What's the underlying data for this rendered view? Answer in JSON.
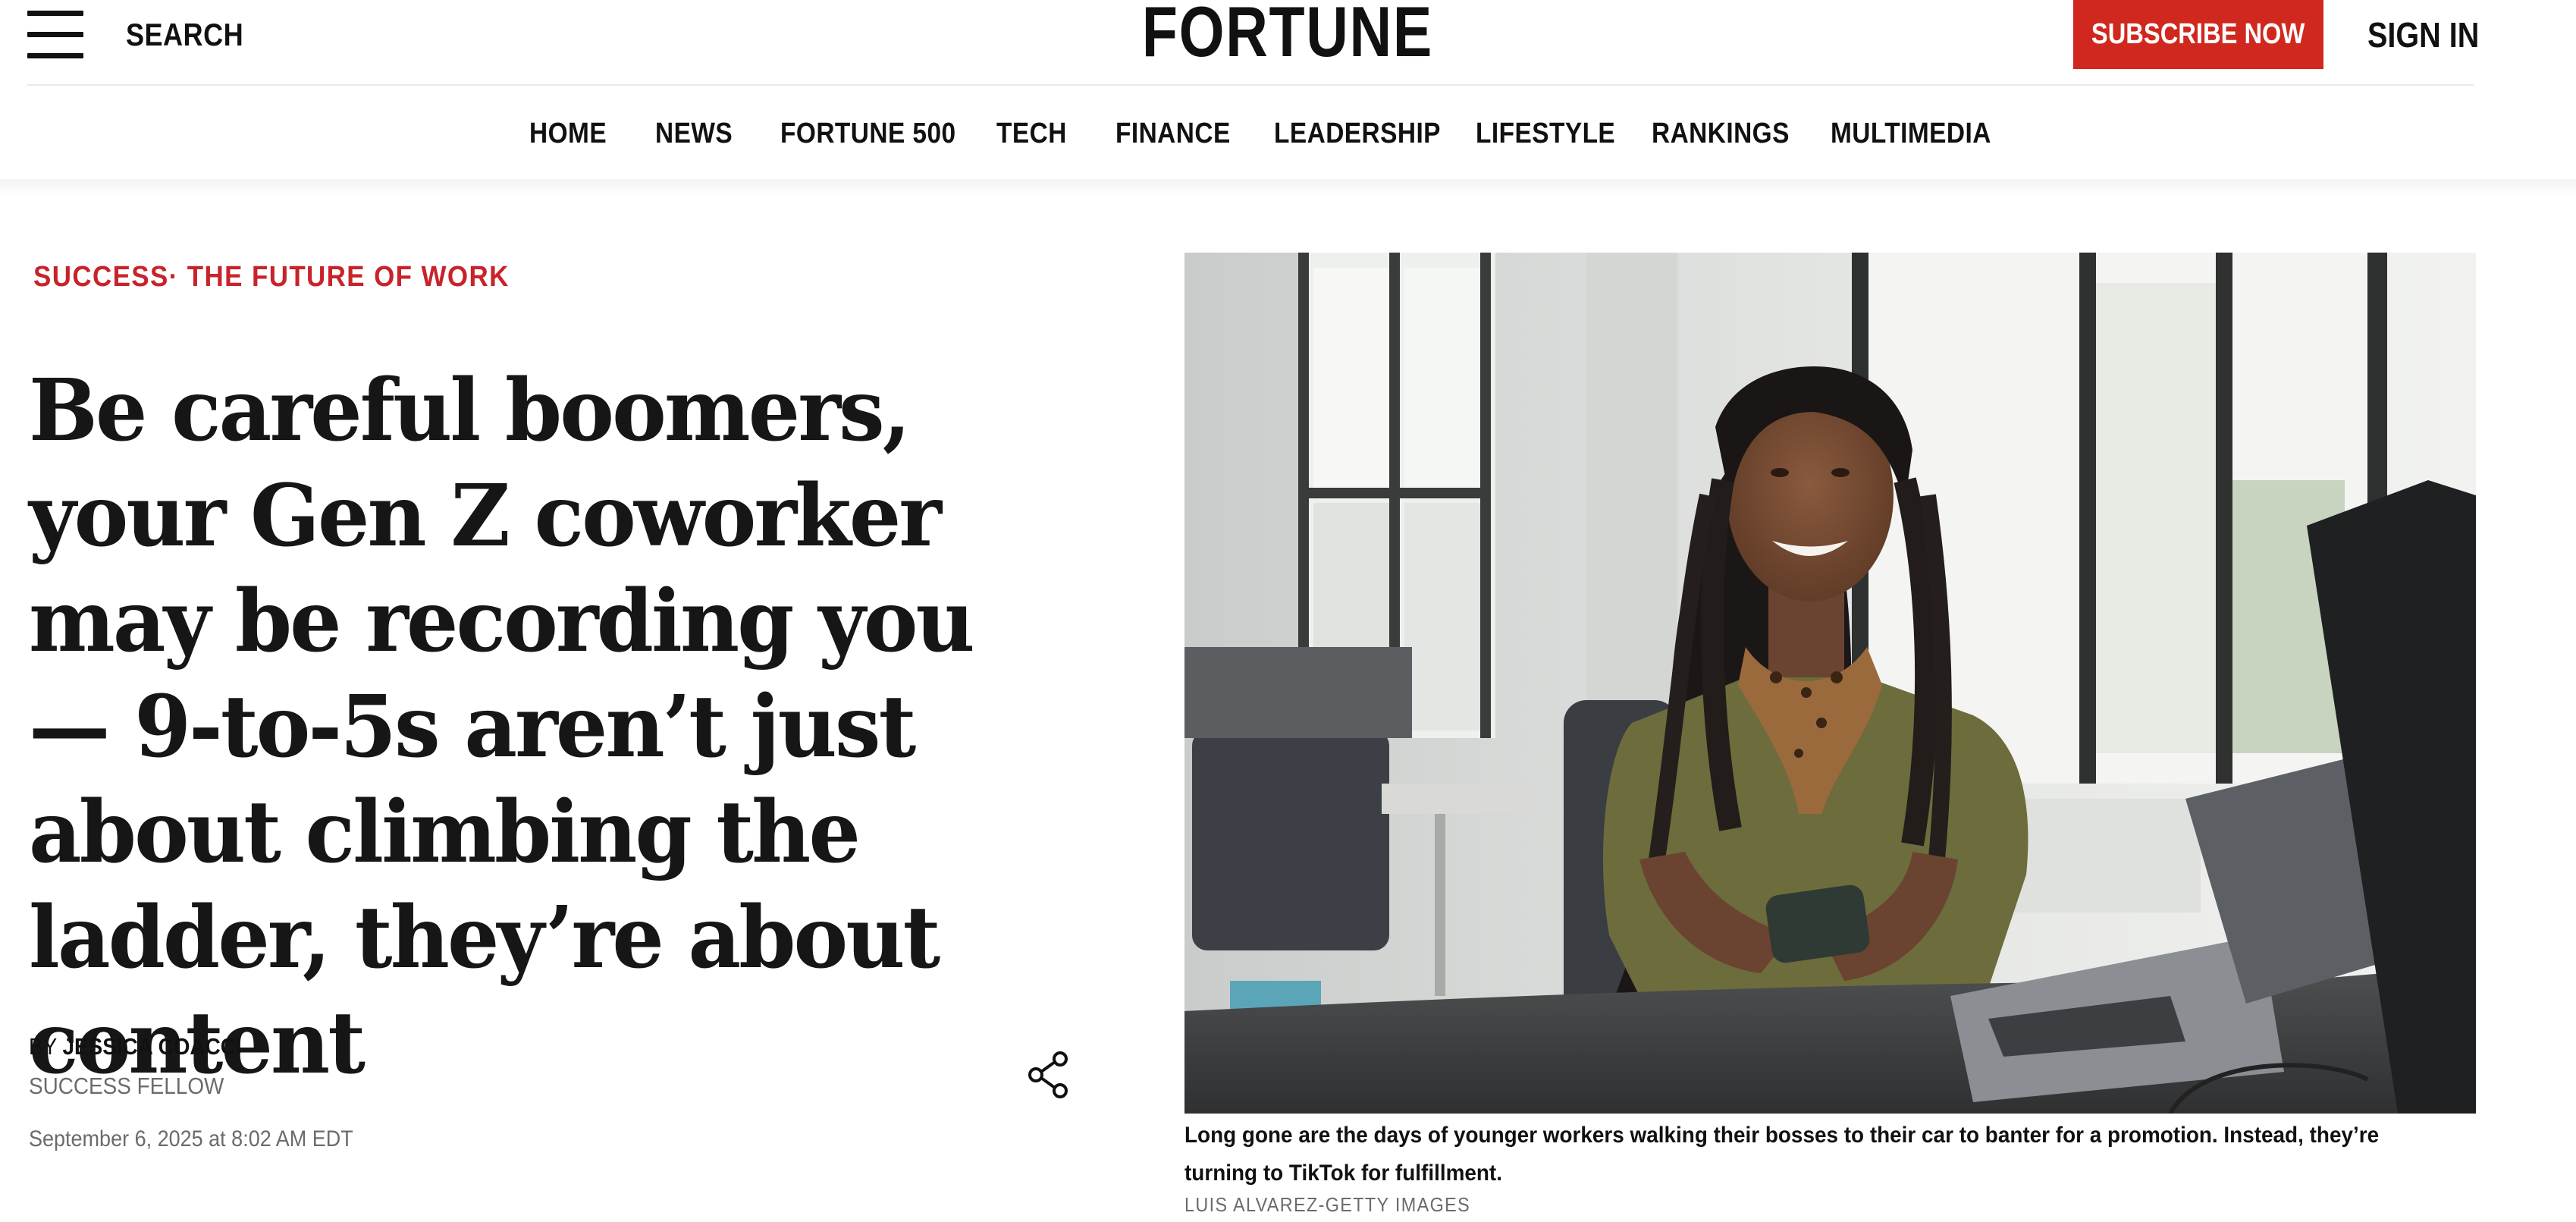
{
  "header": {
    "search_label": "SEARCH",
    "logo_text": "FORTUNE",
    "subscribe_label": "SUBSCRIBE NOW",
    "signin_label": "SIGN IN",
    "menu_icon": "hamburger-menu-icon"
  },
  "nav": {
    "items": [
      "HOME",
      "NEWS",
      "FORTUNE 500",
      "TECH",
      "FINANCE",
      "LEADERSHIP",
      "LIFESTYLE",
      "RANKINGS",
      "MULTIMEDIA"
    ]
  },
  "article": {
    "section": "SUCCESS",
    "separator": "·",
    "subsection": "THE FUTURE OF WORK",
    "headline": "Be careful boomers, your Gen Z coworker may be recording you — 9-to-5s aren’t just about climbing the ladder, they’re about content",
    "byline_prefix": "BY ",
    "author": "JESSICA COACCI",
    "author_title": "SUCCESS FELLOW",
    "date": "September 6, 2025 at 8:02 AM EDT",
    "share_icon": "share-icon",
    "image": {
      "caption": "Long gone are the days of younger workers walking their bosses to their car to banter for a promotion. Instead, they’re turning to TikTok for fulfillment.",
      "credit": "LUIS ALVAREZ-GETTY IMAGES"
    }
  },
  "colors": {
    "accent_red": "#d0281e",
    "kicker_red": "#c8232b",
    "text": "#111111",
    "muted": "#6b6b6b"
  }
}
